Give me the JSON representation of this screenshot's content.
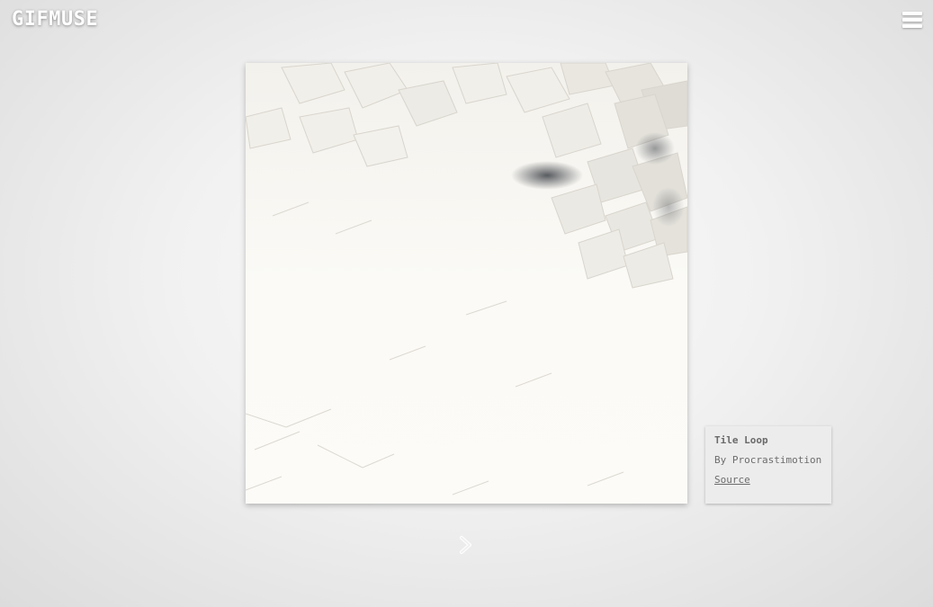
{
  "header": {
    "logo": "GIFMUSE",
    "menu_icon": "hamburger-menu-icon"
  },
  "gif": {
    "description_icon": "geometric-tile-animation-image"
  },
  "info": {
    "title": "Tile Loop",
    "author": "By Procrastimotion",
    "source_label": "Source"
  },
  "navigation": {
    "next_icon": "chevron-right-icon"
  },
  "colors": {
    "background": "#ececec",
    "logo": "#ffffff",
    "card": "#ececec",
    "card_text": "#6d6d6d",
    "gif_base": "#fbfaf6"
  }
}
